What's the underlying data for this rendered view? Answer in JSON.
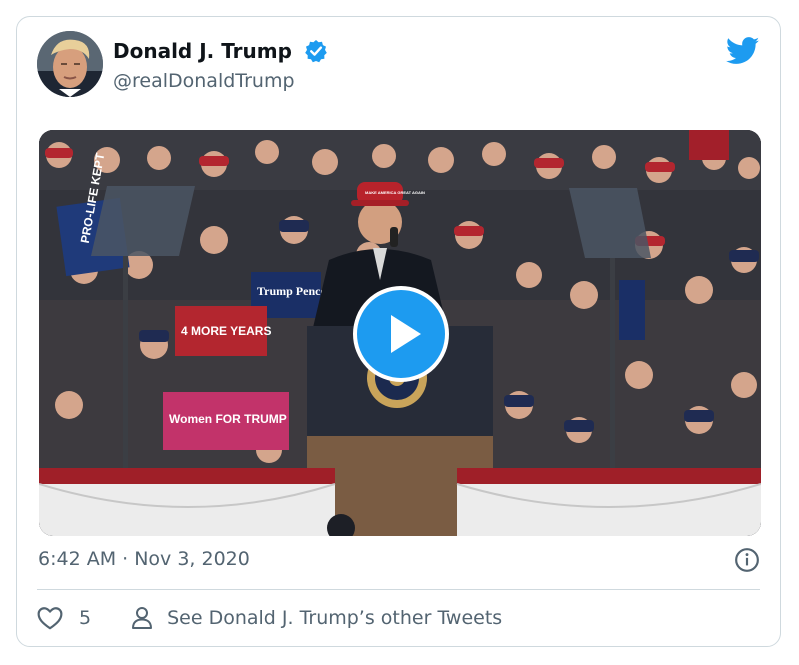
{
  "author": {
    "display_name": "Donald J. Trump",
    "handle": "@realDonaldTrump",
    "avatar_icon": "profile-photo",
    "verified_icon": "verified-badge-icon"
  },
  "media": {
    "type": "video",
    "play_icon": "play-icon",
    "signs": {
      "sign_1": "PRO-LIFE KEPT",
      "sign_2": "Trump Pence 2020",
      "sign_3": "4 MORE YEARS",
      "sign_4": "Women FOR TRUMP",
      "sign_5": "MAKE AMERICA GREAT AGAIN"
    }
  },
  "timestamp": "6:42 AM · Nov 3, 2020",
  "actions": {
    "like_count": "5",
    "other_tweets_label": "See Donald J. Trump’s other Tweets"
  },
  "icons": {
    "brand": "twitter-bird-icon",
    "info": "info-icon",
    "like": "heart-icon",
    "profile": "person-icon"
  },
  "colors": {
    "accent": "#1d9bf0",
    "text_primary": "#0f1419",
    "text_secondary": "#536471",
    "border": "#cfd9de"
  }
}
